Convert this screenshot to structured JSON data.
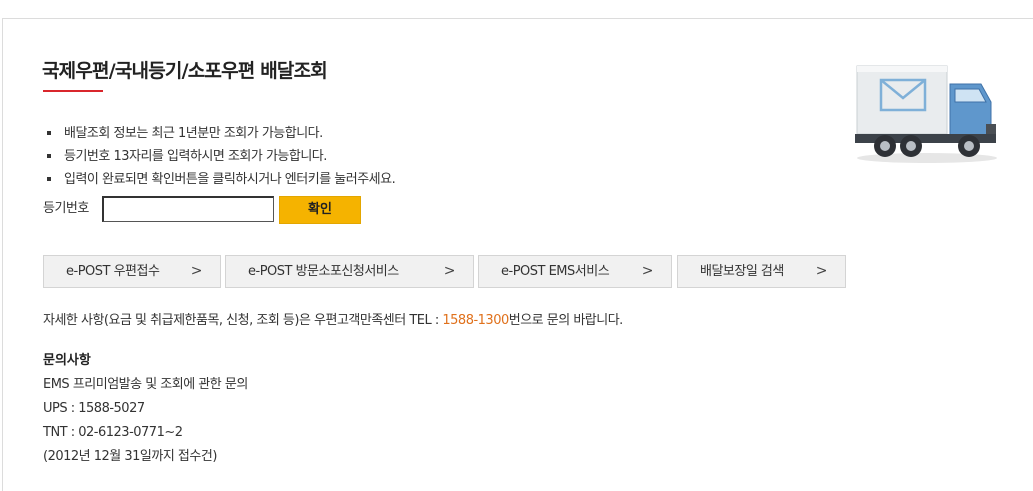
{
  "header": {
    "title": "국제우편/국내등기/소포우편 배달조회"
  },
  "notes": [
    "배달조회 정보는 최근 1년분만 조회가 가능합니다.",
    "등기번호 13자리를 입력하시면 조회가 가능합니다.",
    "입력이 완료되면 확인버튼을 클릭하시거나 엔터키를 눌러주세요."
  ],
  "search": {
    "label": "등기번호",
    "value": "",
    "button_label": "확인"
  },
  "services": [
    {
      "label": "e-POST 우편접수",
      "icon": "chevron-right-icon"
    },
    {
      "label": "e-POST 방문소포신청서비스",
      "icon": "chevron-right-icon"
    },
    {
      "label": "e-POST EMS서비스",
      "icon": "chevron-right-icon"
    },
    {
      "label": "배달보장일 검색",
      "icon": "chevron-right-icon"
    }
  ],
  "chevron": ">",
  "contact": {
    "prefix": "자세한 사항(요금 및 취급제한품목, 신청, 조회 등)은 우편고객만족센터 TEL : ",
    "phone": "1588-1300",
    "suffix": "번으로 문의 바랍니다."
  },
  "inquiry": {
    "title": "문의사항",
    "lines": [
      "EMS 프리미엄발송 및 조회에 관한 문의",
      "UPS : 1588-5027",
      "TNT : 02-6123-0771~2",
      "(2012년 12월 31일까지 접수건)"
    ]
  },
  "colors": {
    "accent_red": "#d9262c",
    "button_yellow": "#f5b300",
    "phone_orange": "#e0711c"
  },
  "illustration": "delivery-truck-icon"
}
